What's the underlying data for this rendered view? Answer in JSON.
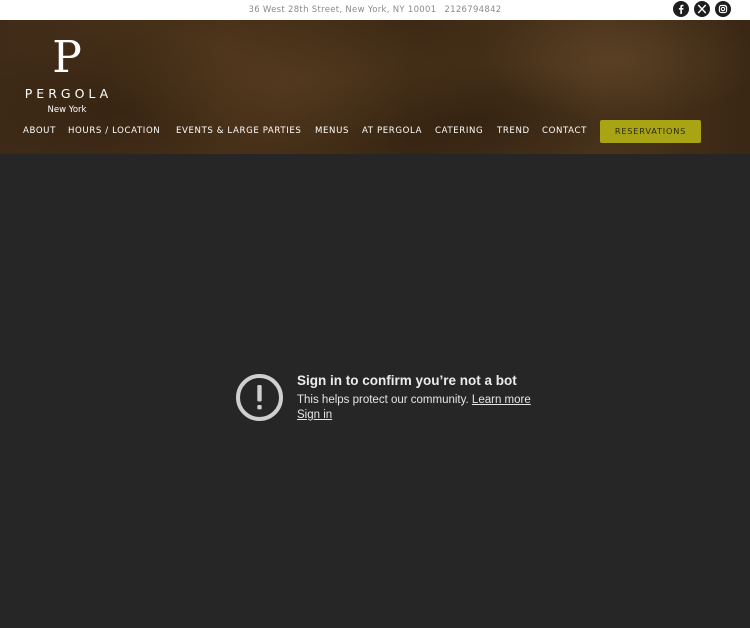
{
  "topbar": {
    "address": "36 West 28th Street, New York, NY 10001",
    "phone": "2126794842",
    "social": [
      {
        "icon": "facebook-icon",
        "glyph": "f"
      },
      {
        "icon": "x-twitter-icon",
        "glyph": "X"
      },
      {
        "icon": "instagram-icon",
        "glyph": "ig"
      }
    ]
  },
  "logo": {
    "mark": "P",
    "name": "PERGOLA",
    "sub": "New York"
  },
  "nav": {
    "about": "ABOUT",
    "hours": "HOURS / LOCATION",
    "events": "EVENTS & LARGE PARTIES",
    "menus": "MENUS",
    "at_pergola": "AT PERGOLA",
    "catering": "CATERING",
    "trend": "TREND",
    "contact": "CONTACT",
    "reservations": "RESERVATIONS"
  },
  "embed": {
    "title": "Sign in to confirm you’re not a bot",
    "description": "This helps protect our community.",
    "learn_more": "Learn more",
    "sign_in": "Sign in",
    "icon": "alert-circle-icon"
  },
  "colors": {
    "header_brown": "#3f2b17",
    "content_bg": "#262626",
    "reservations_button": "#a9a413",
    "topbar_bg": "#ffffff"
  }
}
